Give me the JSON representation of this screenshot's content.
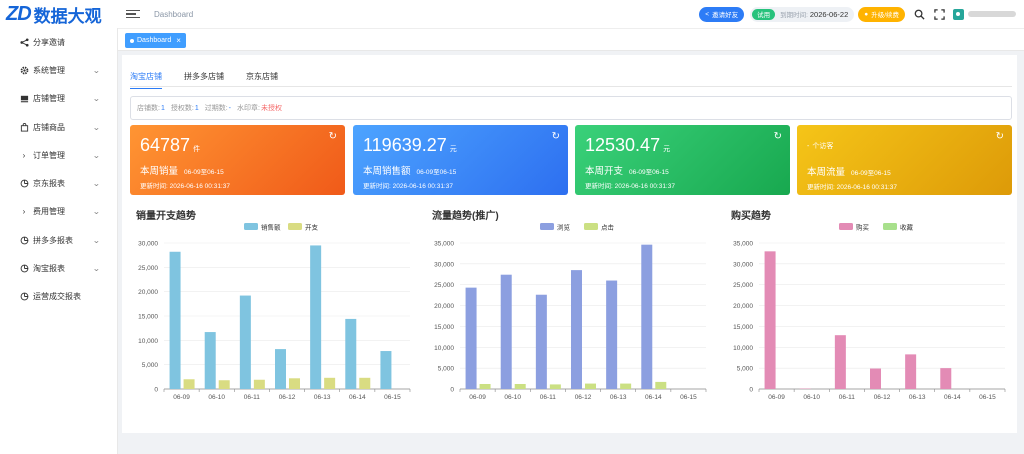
{
  "logo": {
    "mark": "ZD",
    "text": "数据大观"
  },
  "header": {
    "breadcrumb": "Dashboard",
    "invite_label": "邀请好友",
    "trial_label": "试用",
    "expire_label": "到期时间:",
    "expire_date": "2026-06-22",
    "upgrade_label": "升级/续费",
    "search_icon": "⌕",
    "fullscreen_icon": "⛶"
  },
  "sidebar": {
    "items": [
      {
        "label": "分享邀请",
        "icon": "share-icon",
        "has_arrow": false
      },
      {
        "label": "系统管理",
        "icon": "gear-icon",
        "has_arrow": true
      },
      {
        "label": "店铺管理",
        "icon": "store-icon",
        "has_arrow": true
      },
      {
        "label": "店铺商品",
        "icon": "bag-icon",
        "has_arrow": true
      },
      {
        "label": "订单管理",
        "icon": "chevron-right-icon",
        "has_arrow": true
      },
      {
        "label": "京东报表",
        "icon": "pie-chart-icon",
        "has_arrow": true
      },
      {
        "label": "费用管理",
        "icon": "chevron-right-icon",
        "has_arrow": true
      },
      {
        "label": "拼多多报表",
        "icon": "pie-chart-icon",
        "has_arrow": true
      },
      {
        "label": "淘宝报表",
        "icon": "pie-chart-icon",
        "has_arrow": true
      },
      {
        "label": "运营成交报表",
        "icon": "pie-chart-icon",
        "has_arrow": false
      }
    ]
  },
  "tags": {
    "active_label": "Dashboard",
    "close_icon": "×"
  },
  "shop_tabs": [
    "淘宝店铺",
    "拼多多店铺",
    "京东店铺"
  ],
  "info_bar": {
    "store_count_label": "店铺数:",
    "store_count": "1",
    "auth_count_label": "授权数:",
    "auth_count": "1",
    "expired_label": "过期数:",
    "expired_count": "-",
    "watermark_label": "水印章:",
    "watermark_value": "未授权"
  },
  "cards": [
    {
      "value": "64787",
      "unit": "件",
      "title": "本周销量",
      "range": "06-09至06-15",
      "updated": "更新时间: 2026-06-16 00:31:37",
      "color_from": "#ff9533",
      "color_to": "#f05a19"
    },
    {
      "value": "119639.27",
      "unit": "元",
      "title": "本周销售额",
      "range": "06-09至06-15",
      "updated": "更新时间: 2026-06-16 00:31:37",
      "color_from": "#4da4ff",
      "color_to": "#2d6ff0"
    },
    {
      "value": "12530.47",
      "unit": "元",
      "title": "本周开支",
      "range": "06-09至06-15",
      "updated": "更新时间: 2026-06-16 00:31:37",
      "color_from": "#3ad17a",
      "color_to": "#18a84f"
    },
    {
      "value": "-",
      "unit": "个访客",
      "title": "本周流量",
      "range": "06-09至06-15",
      "updated": "更新时间: 2026-06-16 00:31:37",
      "color_from": "#f5c518",
      "color_to": "#dd9a08"
    }
  ],
  "charts": {
    "sales_title": "销量开支趋势",
    "traffic_title": "流量趋势(推广)",
    "purchase_title": "购买趋势"
  },
  "chart_data": [
    {
      "type": "bar",
      "title": "销量开支趋势",
      "categories": [
        "06-09",
        "06-10",
        "06-11",
        "06-12",
        "06-13",
        "06-14",
        "06-15"
      ],
      "series": [
        {
          "name": "销售额",
          "values": [
            28200,
            11700,
            19200,
            8200,
            29500,
            14400,
            7800
          ],
          "color": "#7fc4e0"
        },
        {
          "name": "开支",
          "values": [
            2000,
            1800,
            1900,
            2200,
            2300,
            2300,
            0
          ],
          "color": "#d9dc82"
        }
      ],
      "ylim": [
        0,
        30000
      ],
      "yticks": [
        0,
        5000,
        10000,
        15000,
        20000,
        25000,
        30000
      ],
      "ytick_labels": [
        "0",
        "5,000",
        "10,000",
        "15,000",
        "20,000",
        "25,000",
        "30,000"
      ],
      "legend": "top-center"
    },
    {
      "type": "bar",
      "title": "流量趋势(推广)",
      "categories": [
        "06-09",
        "06-10",
        "06-11",
        "06-12",
        "06-13",
        "06-14",
        "06-15"
      ],
      "series": [
        {
          "name": "浏览",
          "values": [
            24300,
            27400,
            22600,
            28500,
            26000,
            34600,
            0
          ],
          "color": "#8c9fe0"
        },
        {
          "name": "点击",
          "values": [
            1200,
            1200,
            1100,
            1300,
            1300,
            1700,
            0
          ],
          "color": "#cbe083"
        }
      ],
      "ylim": [
        0,
        35000
      ],
      "yticks": [
        0,
        5000,
        10000,
        15000,
        20000,
        25000,
        30000,
        35000
      ],
      "ytick_labels": [
        "0",
        "5,000",
        "10,000",
        "15,000",
        "20,000",
        "25,000",
        "30,000",
        "35,000"
      ],
      "legend": "top-center"
    },
    {
      "type": "bar",
      "title": "购买趋势",
      "categories": [
        "06-09",
        "06-10",
        "06-11",
        "06-12",
        "06-13",
        "06-14",
        "06-15"
      ],
      "series": [
        {
          "name": "购买",
          "values": [
            33000,
            100,
            12900,
            4900,
            8300,
            5000,
            0
          ],
          "color": "#e38bb5"
        },
        {
          "name": "收藏",
          "values": [
            0,
            0,
            0,
            0,
            0,
            0,
            0
          ],
          "color": "#a8e08c"
        }
      ],
      "ylim": [
        0,
        35000
      ],
      "yticks": [
        0,
        5000,
        10000,
        15000,
        20000,
        25000,
        30000,
        35000
      ],
      "ytick_labels": [
        "0",
        "5,000",
        "10,000",
        "15,000",
        "20,000",
        "25,000",
        "30,000",
        "35,000"
      ],
      "legend": "top-center"
    }
  ]
}
